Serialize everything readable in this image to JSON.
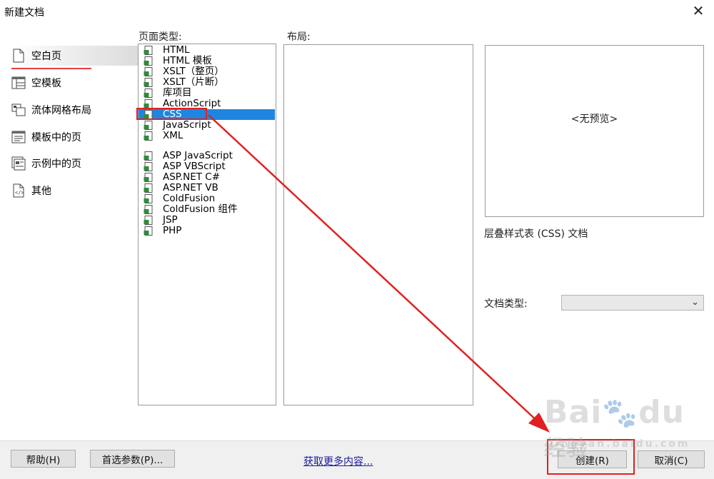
{
  "window": {
    "title": "新建文档",
    "close_glyph": "✕"
  },
  "categories": [
    {
      "label": "空白页",
      "icon": "blank-page-icon",
      "selected": true
    },
    {
      "label": "空模板",
      "icon": "template-icon",
      "selected": false
    },
    {
      "label": "流体网格布局",
      "icon": "fluid-grid-icon",
      "selected": false
    },
    {
      "label": "模板中的页",
      "icon": "template-page-icon",
      "selected": false
    },
    {
      "label": "示例中的页",
      "icon": "sample-page-icon",
      "selected": false
    },
    {
      "label": "其他",
      "icon": "code-file-icon",
      "selected": false
    }
  ],
  "page_types": {
    "label": "页面类型:",
    "items": [
      {
        "label": "HTML",
        "selected": false
      },
      {
        "label": "HTML 模板",
        "selected": false
      },
      {
        "label": "XSLT（整页）",
        "selected": false
      },
      {
        "label": "XSLT（片断）",
        "selected": false
      },
      {
        "label": "库项目",
        "selected": false
      },
      {
        "label": "ActionScript",
        "selected": false
      },
      {
        "label": "CSS",
        "selected": true
      },
      {
        "label": "JavaScript",
        "selected": false
      },
      {
        "label": "XML",
        "selected": false
      },
      {
        "label": "ASP JavaScript",
        "selected": false
      },
      {
        "label": "ASP VBScript",
        "selected": false
      },
      {
        "label": "ASP.NET C#",
        "selected": false
      },
      {
        "label": "ASP.NET VB",
        "selected": false
      },
      {
        "label": "ColdFusion",
        "selected": false
      },
      {
        "label": "ColdFusion 组件",
        "selected": false
      },
      {
        "label": "JSP",
        "selected": false
      },
      {
        "label": "PHP",
        "selected": false
      }
    ]
  },
  "layout": {
    "label": "布局:"
  },
  "preview": {
    "text": "<无预览>",
    "description": "层叠样式表 (CSS) 文档"
  },
  "doctype": {
    "label": "文档类型:",
    "value": ""
  },
  "buttons": {
    "help": "帮助(H)",
    "prefs": "首选参数(P)...",
    "more": "获取更多内容...",
    "create": "创建(R)",
    "cancel": "取消(C)"
  },
  "colors": {
    "selection": "#1f86e0",
    "annotation": "#e02020"
  }
}
